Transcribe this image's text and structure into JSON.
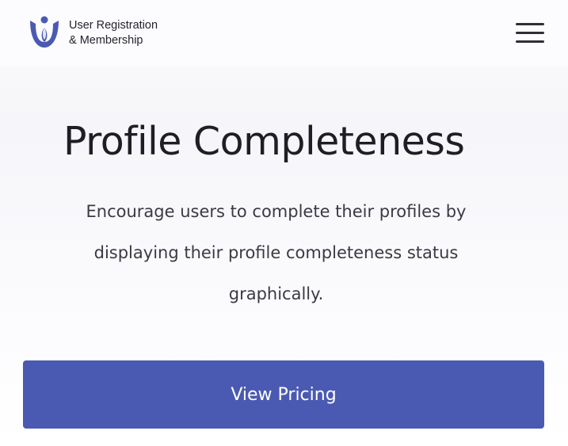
{
  "header": {
    "logo_line1": "User Registration",
    "logo_line2": "& Membership",
    "logo_icon": "user-registration-logo-icon",
    "menu_icon": "hamburger-menu-icon"
  },
  "hero": {
    "title": "Profile Completeness",
    "description_lines": [
      "Encourage users to complete their profiles by",
      "displaying their profile completeness status",
      "graphically."
    ],
    "cta_label": "View Pricing"
  },
  "colors": {
    "brand": "#4a5ab3",
    "text_dark": "#1e1e24",
    "text_body": "#3a3a44",
    "background": "#f8f8fb"
  }
}
